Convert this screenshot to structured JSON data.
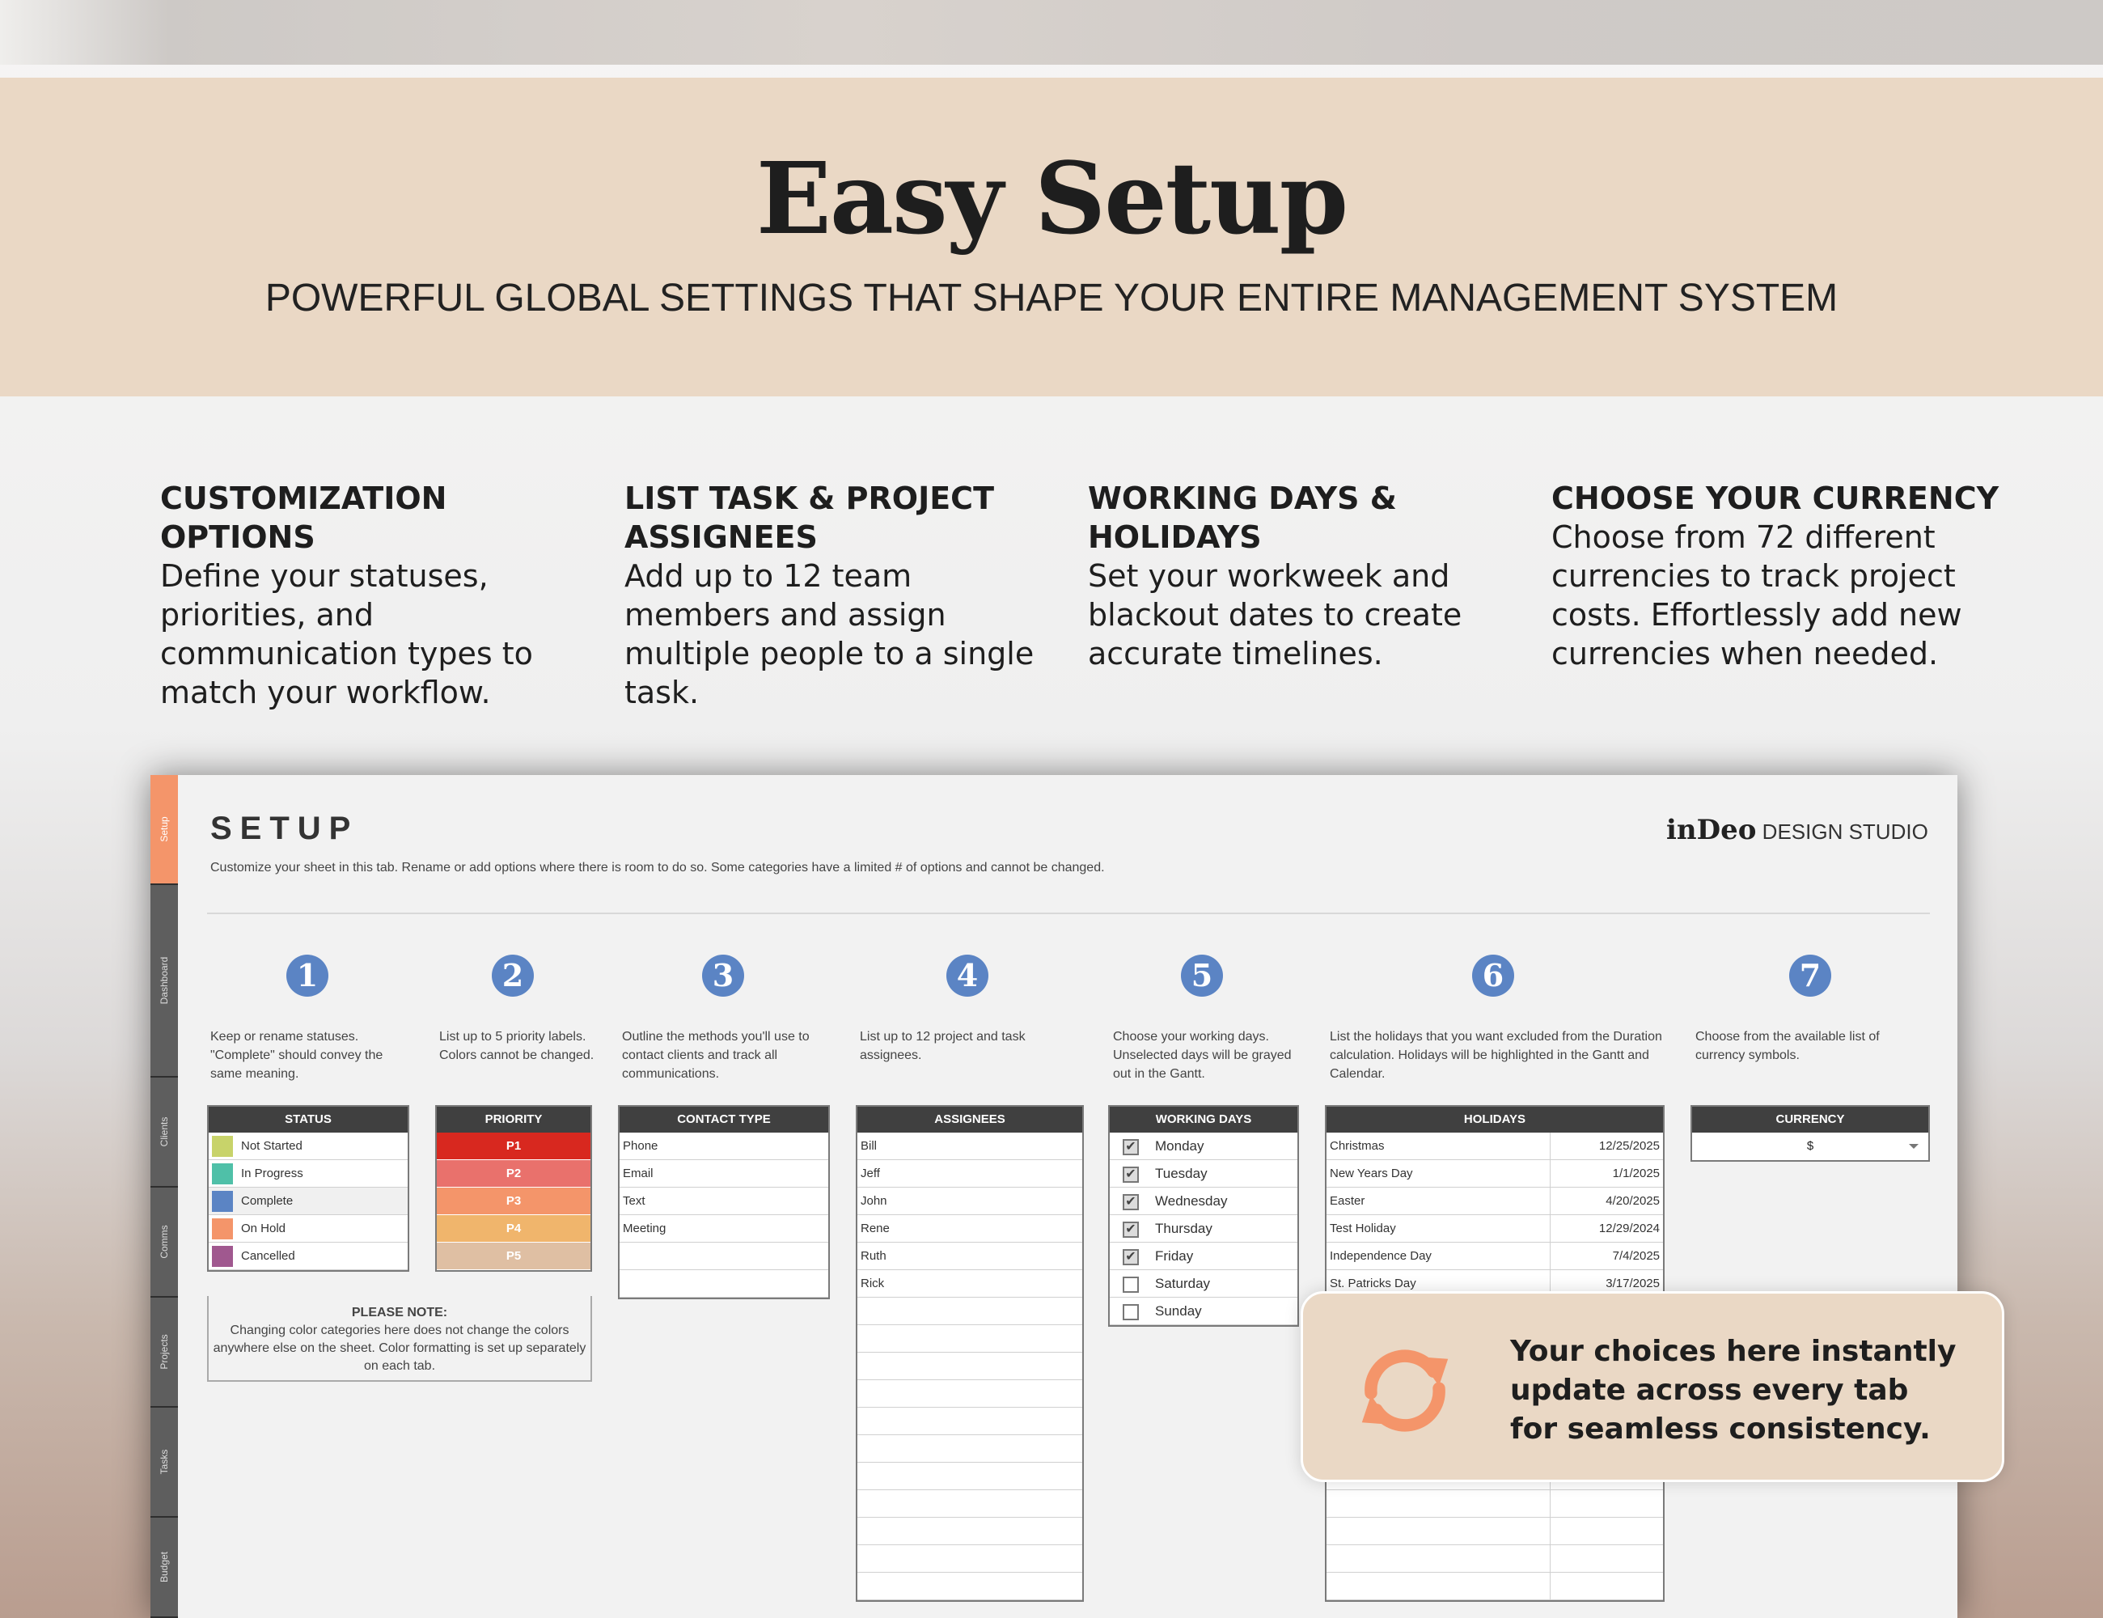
{
  "header": {
    "title": "Easy Setup",
    "subtitle": "POWERFUL GLOBAL SETTINGS THAT SHAPE YOUR ENTIRE MANAGEMENT SYSTEM"
  },
  "features": [
    {
      "title": "CUSTOMIZATION OPTIONS",
      "desc": "Define your statuses, priorities, and communication types to match your workflow."
    },
    {
      "title": "LIST TASK & PROJECT ASSIGNEES",
      "desc": "Add up to 12 team members and assign multiple people to a single task."
    },
    {
      "title": "WORKING DAYS & HOLIDAYS",
      "desc": "Set your workweek and blackout dates to create accurate timelines."
    },
    {
      "title": "CHOOSE YOUR CURRENCY",
      "desc": "Choose from 72 different currencies to track project costs. Effortlessly add new currencies when needed."
    }
  ],
  "sheet": {
    "tabs": [
      "Setup",
      "Dashboard",
      "Clients",
      "Comms",
      "Projects",
      "Tasks",
      "Budget"
    ],
    "title": "SETUP",
    "description": "Customize your sheet in this tab. Rename or add options where there is room to do so. Some categories have a limited # of options and cannot be changed.",
    "logo_brand": "inDeo",
    "logo_studio": "DESIGN STUDIO",
    "numbers": [
      "1",
      "2",
      "3",
      "4",
      "5",
      "6",
      "7"
    ],
    "hints": [
      "Keep or rename statuses. \"Complete\" should convey the same meaning.",
      "List up to 5 priority labels. Colors cannot be changed.",
      "Outline the methods you'll use to contact clients and track all communications.",
      "List up to 12 project and task assignees.",
      "Choose your working days. Unselected days will be grayed out in the Gantt.",
      "List the holidays that you want excluded from the Duration calculation. Holidays will be highlighted in the Gantt and Calendar.",
      "Choose from the available list of currency symbols."
    ],
    "status": {
      "header": "STATUS",
      "items": [
        {
          "label": "Not Started",
          "color": "#c8d36a"
        },
        {
          "label": "In Progress",
          "color": "#4fc0a8"
        },
        {
          "label": "Complete",
          "color": "#5b84c4"
        },
        {
          "label": "On Hold",
          "color": "#f4956a"
        },
        {
          "label": "Cancelled",
          "color": "#a0588f"
        }
      ]
    },
    "priority": {
      "header": "PRIORITY",
      "items": [
        {
          "label": "P1",
          "color": "#d8281f"
        },
        {
          "label": "P2",
          "color": "#e9716c"
        },
        {
          "label": "P3",
          "color": "#f4956a"
        },
        {
          "label": "P4",
          "color": "#f0b56c"
        },
        {
          "label": "P5",
          "color": "#dfbfa3"
        }
      ]
    },
    "contact_type": {
      "header": "CONTACT TYPE",
      "items": [
        "Phone",
        "Email",
        "Text",
        "Meeting"
      ]
    },
    "assignees": {
      "header": "ASSIGNEES",
      "items": [
        "Bill",
        "Jeff",
        "John",
        "Rene",
        "Ruth",
        "Rick"
      ]
    },
    "working_days": {
      "header": "WORKING DAYS",
      "items": [
        {
          "label": "Monday",
          "checked": true
        },
        {
          "label": "Tuesday",
          "checked": true
        },
        {
          "label": "Wednesday",
          "checked": true
        },
        {
          "label": "Thursday",
          "checked": true
        },
        {
          "label": "Friday",
          "checked": true
        },
        {
          "label": "Saturday",
          "checked": false
        },
        {
          "label": "Sunday",
          "checked": false
        }
      ]
    },
    "holidays": {
      "header": "HOLIDAYS",
      "items": [
        {
          "name": "Christmas",
          "date": "12/25/2025"
        },
        {
          "name": "New Years Day",
          "date": "1/1/2025"
        },
        {
          "name": "Easter",
          "date": "4/20/2025"
        },
        {
          "name": "Test Holiday",
          "date": "12/29/2024"
        },
        {
          "name": "Independence Day",
          "date": "7/4/2025"
        },
        {
          "name": "St. Patricks Day",
          "date": "3/17/2025"
        }
      ]
    },
    "currency": {
      "header": "CURRENCY",
      "value": "$"
    },
    "note": {
      "title": "PLEASE NOTE:",
      "text": "Changing color categories here does not change the colors anywhere else on the sheet. Color formatting is set up separately on each tab."
    }
  },
  "callout": {
    "text": "Your choices here instantly update across every tab for seamless consistency.",
    "icon": "refresh-icon",
    "color": "#f4956a"
  }
}
